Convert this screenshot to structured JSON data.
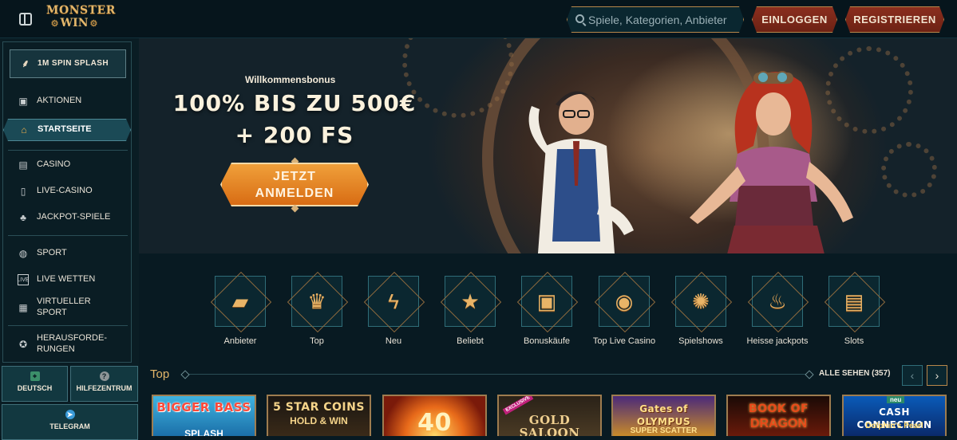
{
  "header": {
    "logo_line1": "MONSTER",
    "logo_line2": "WIN",
    "search_placeholder": "Spiele, Kategorien, Anbieter",
    "login_label": "EINLOGGEN",
    "register_label": "REGISTRIEREN"
  },
  "sidebar": {
    "promo_label": "1M SPIN SPLASH",
    "items": [
      {
        "label": "AKTIONEN",
        "icon": "gift-icon"
      },
      {
        "label": "STARTSEITE",
        "icon": "home-icon"
      },
      {
        "label": "CASINO",
        "icon": "slot-machine-icon"
      },
      {
        "label": "LIVE-CASINO",
        "icon": "playing-card-icon"
      },
      {
        "label": "JACKPOT-SPIELE",
        "icon": "clover-icon"
      },
      {
        "label": "SPORT",
        "icon": "ball-icon"
      },
      {
        "label": "LIVE WETTEN",
        "icon": "live-icon"
      },
      {
        "label": "VIRTUELLER SPORT",
        "icon": "virtual-sport-icon"
      },
      {
        "label": "HERAUSFORDE-RUNGEN",
        "icon": "challenge-icon"
      }
    ],
    "language_label": "DEUTSCH",
    "help_label": "HILFEZENTRUM",
    "telegram_label": "TELEGRAM"
  },
  "hero": {
    "bonus_label": "Willkommensbonus",
    "title_line1": "100% BIS ZU 500€",
    "title_line2": "+ 200 FS",
    "cta_line1": "JETZT",
    "cta_line2": "ANMELDEN"
  },
  "categories": [
    {
      "label": "Anbieter",
      "icon": "book-icon"
    },
    {
      "label": "Top",
      "icon": "crown-icon"
    },
    {
      "label": "Neu",
      "icon": "lightning-icon"
    },
    {
      "label": "Beliebt",
      "icon": "star-icon"
    },
    {
      "label": "Bonuskäufe",
      "icon": "chest-icon"
    },
    {
      "label": "Top Live Casino",
      "icon": "chip-icon"
    },
    {
      "label": "Spielshows",
      "icon": "wheel-icon"
    },
    {
      "label": "Heisse jackpots",
      "icon": "flame-icon"
    },
    {
      "label": "Slots",
      "icon": "slot-icon"
    }
  ],
  "top_section": {
    "title": "Top",
    "see_all_label": "ALLE SEHEN (357)",
    "games": [
      {
        "title": "BIGGER BASS",
        "subtitle": "SPLASH"
      },
      {
        "title": "5 STAR COINS",
        "subtitle": "HOLD & WIN"
      },
      {
        "title": "40",
        "subtitle": ""
      },
      {
        "title": "GOLD SALOON",
        "subtitle": "",
        "badge": "EXCLUSIVE"
      },
      {
        "title": "Gates of OLYMPUS",
        "subtitle": "SUPER SCATTER"
      },
      {
        "title": "BOOK OF",
        "subtitle": "DRAGON"
      },
      {
        "title": "CASH CONNECTION",
        "subtitle": "Dolphin's Pearl",
        "badge": "neu"
      }
    ]
  },
  "colors": {
    "accent_gold": "#e3b66a",
    "button_red": "#8a2e1e",
    "cta_orange": "#e8861f",
    "teal_active": "#1b4a56"
  }
}
